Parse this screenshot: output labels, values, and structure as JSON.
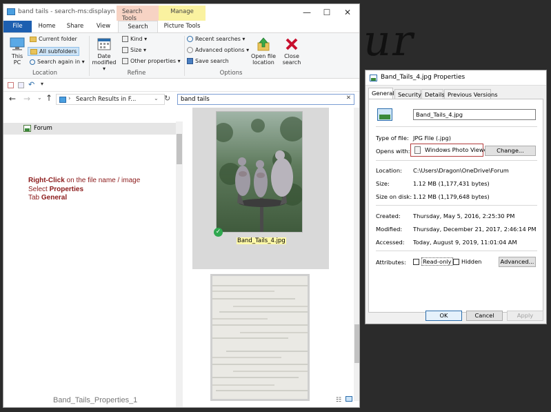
{
  "desktop": {
    "scrawl": "ur",
    "help_glyph": "?"
  },
  "explorer": {
    "title": "band tails - search-ms:displayname...",
    "context_tabs": {
      "search_tools": "Search Tools",
      "manage": "Manage"
    },
    "window_controls": {
      "minimize": "—",
      "maximize": "☐",
      "close": "✕"
    },
    "tabs": [
      "File",
      "Home",
      "Share",
      "View",
      "Search",
      "Picture Tools"
    ],
    "ribbon": {
      "location": {
        "this_pc": "This PC",
        "current_folder": "Current folder",
        "all_subfolders": "All subfolders",
        "search_again": "Search again in ▾",
        "label": "Location"
      },
      "refine": {
        "date_modified": "Date modified ▾",
        "kind": "Kind ▾",
        "size": "Size ▾",
        "other_properties": "Other properties ▾",
        "label": "Refine"
      },
      "options": {
        "recent_searches": "Recent searches ▾",
        "advanced_options": "Advanced options ▾",
        "save_search": "Save search",
        "open_file_location": "Open file location",
        "close_search": "Close search",
        "label": "Options"
      }
    },
    "address": "Search Results in F...",
    "search_value": "band tails",
    "nav_selected": "Forum",
    "instructions": {
      "line1_bold": "Right-Click",
      "line1_rest": " on the file name / image",
      "line2_pre": "Select ",
      "line2_bold": "Properties",
      "line3_pre": "Tab ",
      "line3_bold": "General"
    },
    "caption": "Band_Tails_Properties_1",
    "selected_file": "Band_Tails_4.jpg"
  },
  "properties": {
    "title": "Band_Tails_4.jpg Properties",
    "tabs": [
      "General",
      "Security",
      "Details",
      "Previous Versions"
    ],
    "filename": "Band_Tails_4.jpg",
    "type_label": "Type of file:",
    "type_value": "JPG File (.jpg)",
    "opens_label": "Opens with:",
    "opens_value": "Windows Photo Viewer",
    "change_btn": "Change...",
    "location_label": "Location:",
    "location_value": "C:\\Users\\Dragon\\OneDrive\\Forum",
    "size_label": "Size:",
    "size_value": "1.12 MB (1,177,431 bytes)",
    "size_disk_label": "Size on disk:",
    "size_disk_value": "1.12 MB (1,179,648 bytes)",
    "created_label": "Created:",
    "created_value": "Thursday, May 5, 2016, 2:25:30 PM",
    "modified_label": "Modified:",
    "modified_value": "Thursday, December 21, 2017, 2:46:14 PM",
    "accessed_label": "Accessed:",
    "accessed_value": "Today, August 9, 2019, 11:01:04 AM",
    "attributes_label": "Attributes:",
    "readonly": "Read-only",
    "hidden": "Hidden",
    "advanced_btn": "Advanced...",
    "ok": "OK",
    "cancel": "Cancel",
    "apply": "Apply"
  }
}
